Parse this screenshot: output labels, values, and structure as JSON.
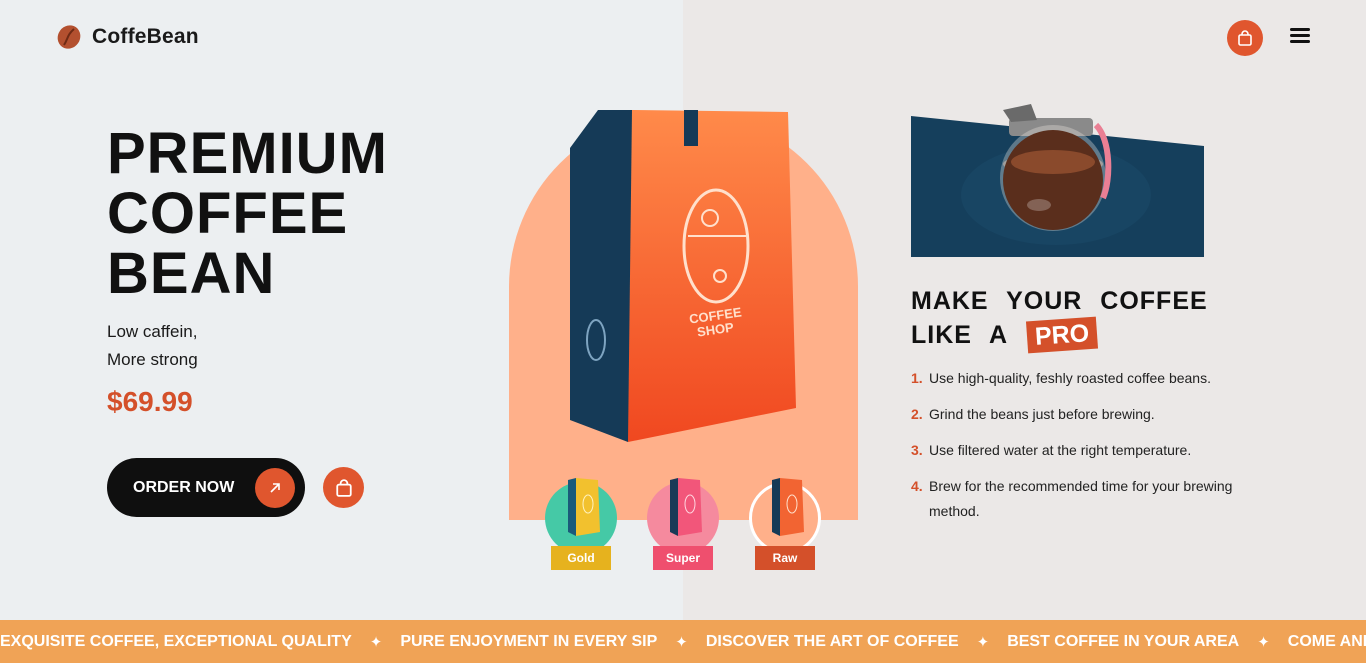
{
  "header": {
    "brand": "CoffeBean",
    "logo_icon": "coffee-bean-icon",
    "cart_icon": "shopping-bag-icon",
    "menu_icon": "hamburger-menu-icon"
  },
  "hero": {
    "title_lines": [
      "PREMIUM",
      "COFFEE",
      "BEAN"
    ],
    "tagline_lines": [
      "Low caffein,",
      "More strong"
    ],
    "price": "$69.99",
    "order_label": "ORDER NOW",
    "order_icon": "arrow-up-right-icon",
    "bag_icon": "shopping-bag-icon"
  },
  "product": {
    "bag_label_line1": "COFFEE",
    "bag_label_line2": "SHOP",
    "variants": [
      {
        "name": "Gold",
        "color": "#f2c12e",
        "circle": "#45c9a6",
        "tag": "#e6b21e",
        "selected": false
      },
      {
        "name": "Super",
        "color": "#f2567a",
        "circle": "#f58a9e",
        "tag": "#ef4f6e",
        "selected": false
      },
      {
        "name": "Raw",
        "color": "#f26432",
        "circle": "#ffb08a",
        "tag": "#d4502a",
        "selected": true
      }
    ]
  },
  "howto": {
    "title_line1": "MAKE YOUR COFFEE",
    "title_line2": "LIKE A",
    "badge": "PRO",
    "steps": [
      {
        "num": "1.",
        "text": "Use high-quality, feshly roasted coffee beans."
      },
      {
        "num": "2.",
        "text": "Grind the beans just before brewing."
      },
      {
        "num": "3.",
        "text": "Use filtered water at the right temperature."
      },
      {
        "num": "4.",
        "text": "Brew for the recommended time for your brewing method."
      }
    ]
  },
  "ticker": {
    "items": [
      "EXQUISITE COFFEE, EXCEPTIONAL QUALITY",
      "PURE ENJOYMENT IN EVERY SIP",
      "DISCOVER THE ART OF COFFEE",
      "BEST COFFEE IN YOUR AREA",
      "COME AND CHILL"
    ],
    "separator": "✦"
  },
  "colors": {
    "accent": "#e0562e",
    "price": "#d4502a",
    "navy": "#143a55",
    "peach": "#ffb08a",
    "ticker_bg": "#f0a356"
  }
}
